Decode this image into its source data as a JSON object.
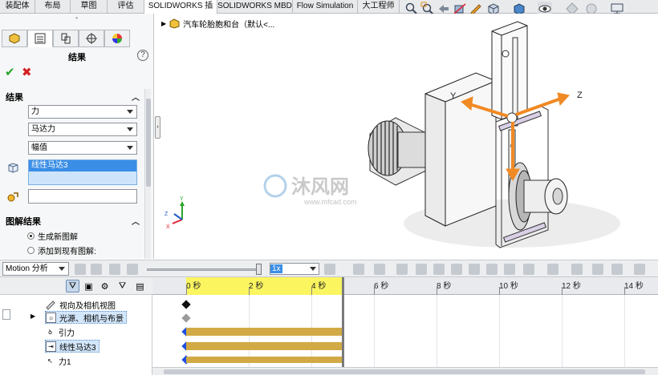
{
  "tabs": [
    {
      "label": "装配体",
      "active": false
    },
    {
      "label": "布局",
      "active": false
    },
    {
      "label": "草图",
      "active": false
    },
    {
      "label": "评估",
      "active": false
    },
    {
      "label": "SOLIDWORKS 插件",
      "active": true
    },
    {
      "label": "SOLIDWORKS MBD",
      "active": false
    },
    {
      "label": "Flow Simulation",
      "active": false
    },
    {
      "label": "大工程师",
      "active": false
    }
  ],
  "property_manager": {
    "title": "结果",
    "section_results": "结果",
    "dropdown_category": "力",
    "dropdown_subcategory": "马达力",
    "dropdown_component": "幅值",
    "selected_feature": "线性马达3",
    "section_plot": "图解结果",
    "radio_new": "生成新图解",
    "radio_add": "添加到现有图解:"
  },
  "graphics": {
    "tree_root": "汽车轮胎胞和台（默认<...",
    "axis_y": "Y",
    "axis_z": "Z",
    "watermark_brand": "沐风网",
    "watermark_url": "www.mfcad.com",
    "triad_y": "Y",
    "triad_x": "X",
    "triad_z": "Z"
  },
  "motion_bar": {
    "study_type": "Motion 分析",
    "speed": "1x"
  },
  "motion_tree": [
    {
      "label": "视向及相机视图",
      "highlight": false
    },
    {
      "label": "光源、相机与布景",
      "highlight": true
    },
    {
      "label": "引力",
      "highlight": false
    },
    {
      "label": "线性马达3",
      "highlight": true
    },
    {
      "label": "力1",
      "highlight": false
    }
  ],
  "timeline": {
    "ticks": [
      "0 秒",
      "2 秒",
      "4 秒",
      "6 秒",
      "8 秒",
      "10 秒",
      "12 秒",
      "14 秒"
    ]
  },
  "colors": {
    "accent": "#3a8ee6",
    "force_arrow": "#f08a24",
    "key_bar": "#d2aa45",
    "ruler_highlight": "#fbf560"
  }
}
